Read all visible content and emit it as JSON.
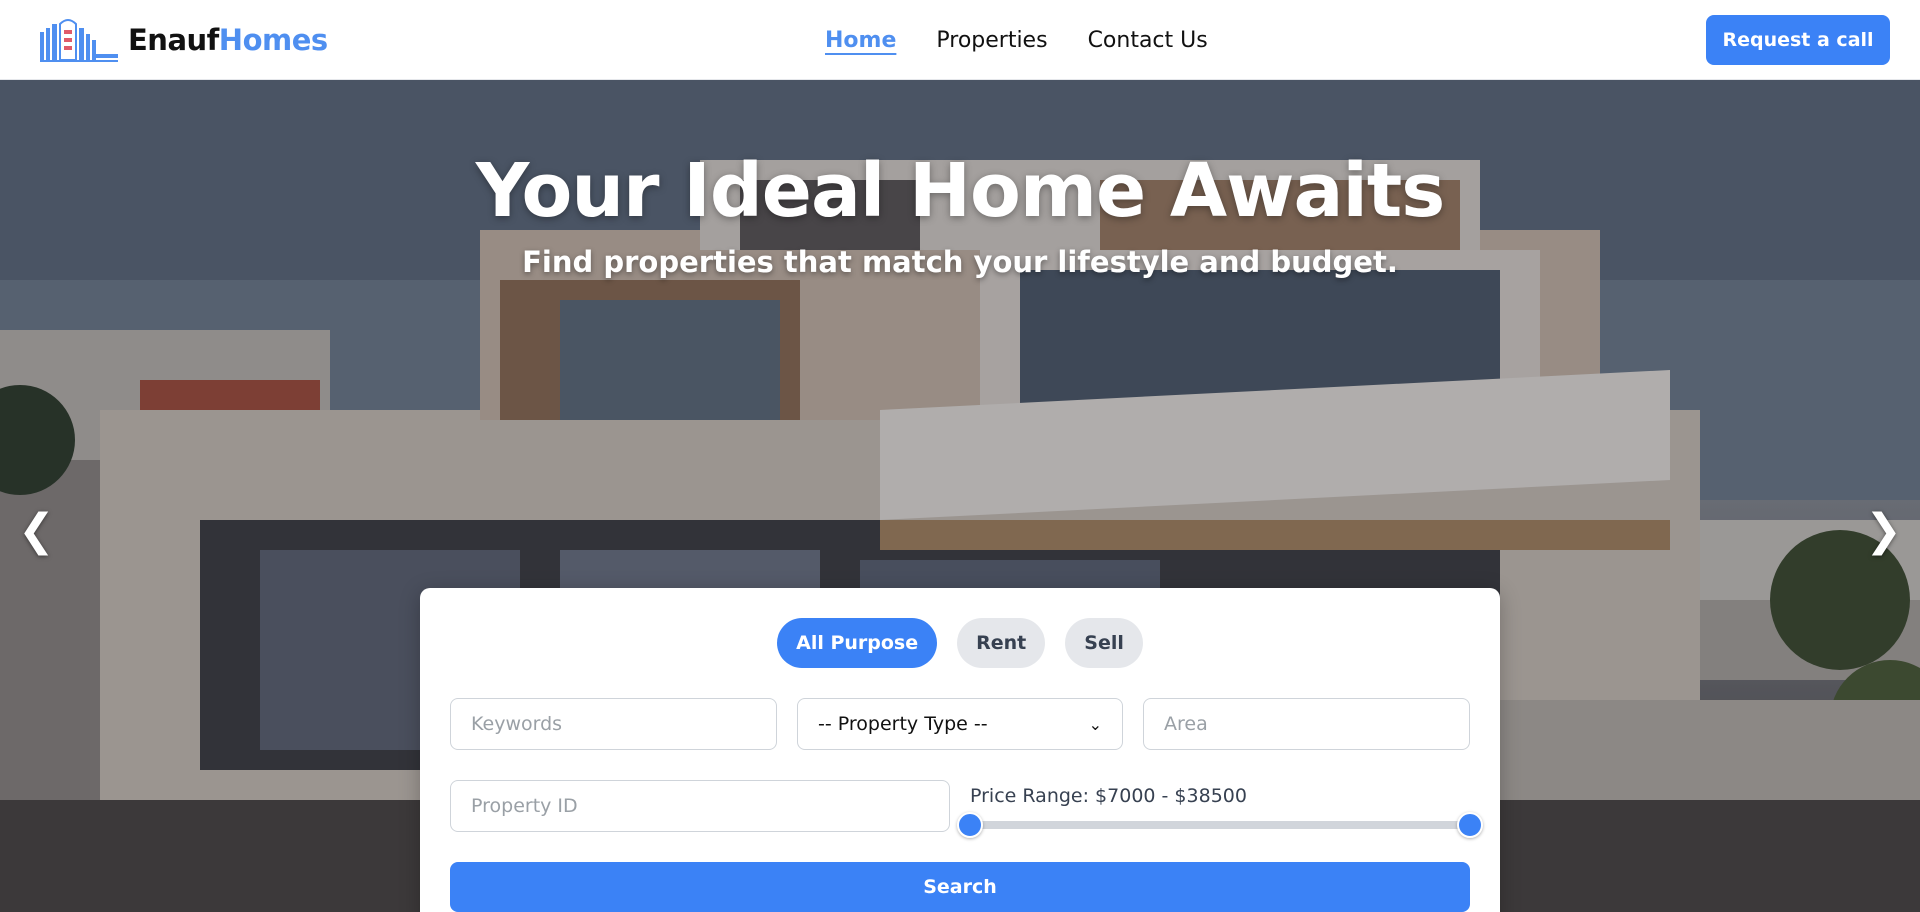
{
  "brand": {
    "name_part1": "Enauf",
    "name_part2": "Homes"
  },
  "nav": {
    "links": [
      {
        "label": "Home",
        "active": true
      },
      {
        "label": "Properties",
        "active": false
      },
      {
        "label": "Contact Us",
        "active": false
      }
    ],
    "cta_label": "Request a call"
  },
  "hero": {
    "title": "Your Ideal Home Awaits",
    "subtitle": "Find properties that match your lifestyle and budget.",
    "prev_arrow": "❮",
    "next_arrow": "❯"
  },
  "search": {
    "tabs": [
      {
        "label": "All Purpose",
        "active": true
      },
      {
        "label": "Rent",
        "active": false
      },
      {
        "label": "Sell",
        "active": false
      }
    ],
    "keywords_placeholder": "Keywords",
    "property_type_value": "-- Property Type --",
    "area_placeholder": "Area",
    "property_id_placeholder": "Property ID",
    "price_range_label": "Price Range: $7000 - $38500",
    "price_min": 7000,
    "price_max": 38500,
    "search_label": "Search"
  },
  "colors": {
    "accent": "#3b82f6",
    "brand_blue": "#4f8ff0"
  },
  "icons": {
    "logo": "building-logo-icon",
    "select": "chevron-down-icon",
    "prev": "chevron-left-icon",
    "next": "chevron-right-icon"
  }
}
